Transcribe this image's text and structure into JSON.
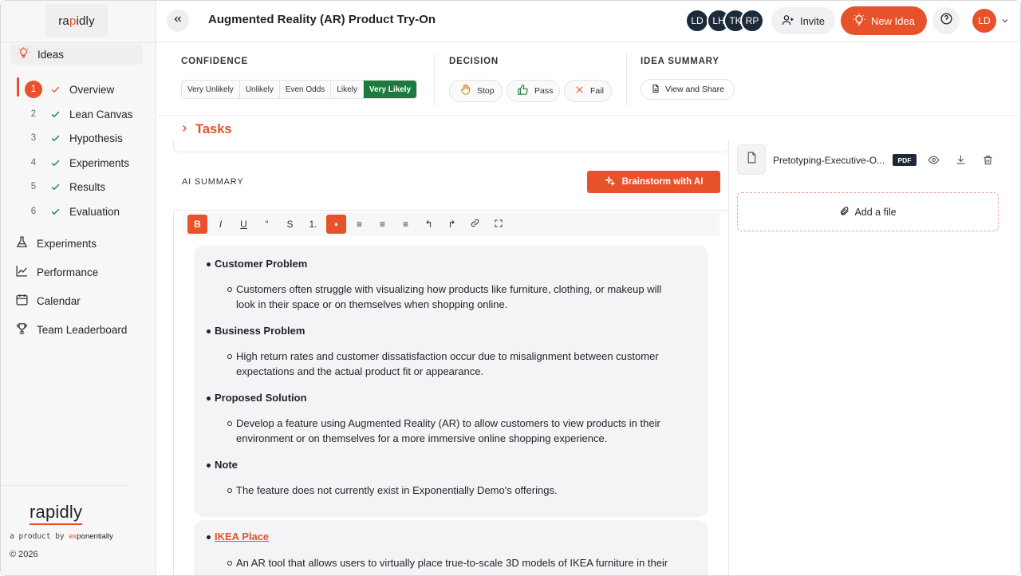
{
  "sidebar": {
    "logo_prefix": "ra",
    "logo_accent": "p",
    "logo_suffix": "idly",
    "ideas_label": "Ideas",
    "steps": [
      {
        "num": "1",
        "label": "Overview"
      },
      {
        "num": "2",
        "label": "Lean Canvas"
      },
      {
        "num": "3",
        "label": "Hypothesis"
      },
      {
        "num": "4",
        "label": "Experiments"
      },
      {
        "num": "5",
        "label": "Results"
      },
      {
        "num": "6",
        "label": "Evaluation"
      }
    ],
    "nav": [
      {
        "label": "Experiments",
        "icon": "flask-icon"
      },
      {
        "label": "Performance",
        "icon": "chart-line-icon"
      },
      {
        "label": "Calendar",
        "icon": "calendar-icon"
      },
      {
        "label": "Team Leaderboard",
        "icon": "trophy-icon"
      }
    ],
    "footer_logo": "rapidly",
    "tagline_prefix": "a product by ",
    "tagline_brand_accent": "ex",
    "tagline_brand": "ponentially",
    "copyright": "© 2026"
  },
  "header": {
    "title": "Augmented Reality (AR) Product Try-On",
    "avatars": [
      "LD",
      "LH",
      "TK",
      "RP"
    ],
    "invite_label": "Invite",
    "new_idea_label": "New Idea",
    "user_initials": "LD"
  },
  "decision_bar": {
    "confidence_label": "CONFIDENCE",
    "confidence_options": [
      "Very Unlikely",
      "Unlikely",
      "Even Odds",
      "Likely",
      "Very Likely"
    ],
    "confidence_selected": "Very Likely",
    "decision_label": "DECISION",
    "decisions": [
      "Stop",
      "Pass",
      "Fail"
    ],
    "summary_label": "IDEA SUMMARY",
    "view_share_label": "View and Share"
  },
  "tasks": {
    "label": "Tasks"
  },
  "ai_summary": {
    "label": "AI SUMMARY",
    "brainstorm_label": "Brainstorm with AI",
    "toolbar": [
      "B",
      "I",
      "U",
      "“",
      "S",
      "1.",
      "•",
      "≡",
      "≡",
      "≡",
      "↰",
      "↱",
      "link",
      "expand"
    ],
    "sections": [
      {
        "title": "Customer Problem",
        "text": "Customers often struggle with visualizing how products like furniture, clothing, or makeup will look in their space or on themselves when shopping online."
      },
      {
        "title": "Business Problem",
        "text": "High return rates and customer dissatisfaction occur due to misalignment between customer expectations and the actual product fit or appearance."
      },
      {
        "title": "Proposed Solution",
        "text": "Develop a feature using Augmented Reality (AR) to allow customers to view products in their environment or on themselves for a more immersive online shopping experience."
      },
      {
        "title": "Note",
        "text": "The feature does not currently exist in Exponentially Demo's offerings."
      }
    ],
    "competitor": {
      "title": "IKEA Place",
      "text": "An AR tool that allows users to virtually place true-to-scale 3D models of IKEA furniture in their rooms."
    }
  },
  "files": {
    "file_name": "Pretotyping-Executive-O...",
    "file_type": "PDF",
    "add_file_label": "Add a file"
  },
  "colors": {
    "accent": "#e8522a",
    "selected_green": "#1c7a3c",
    "navy": "#1d2a3a"
  }
}
